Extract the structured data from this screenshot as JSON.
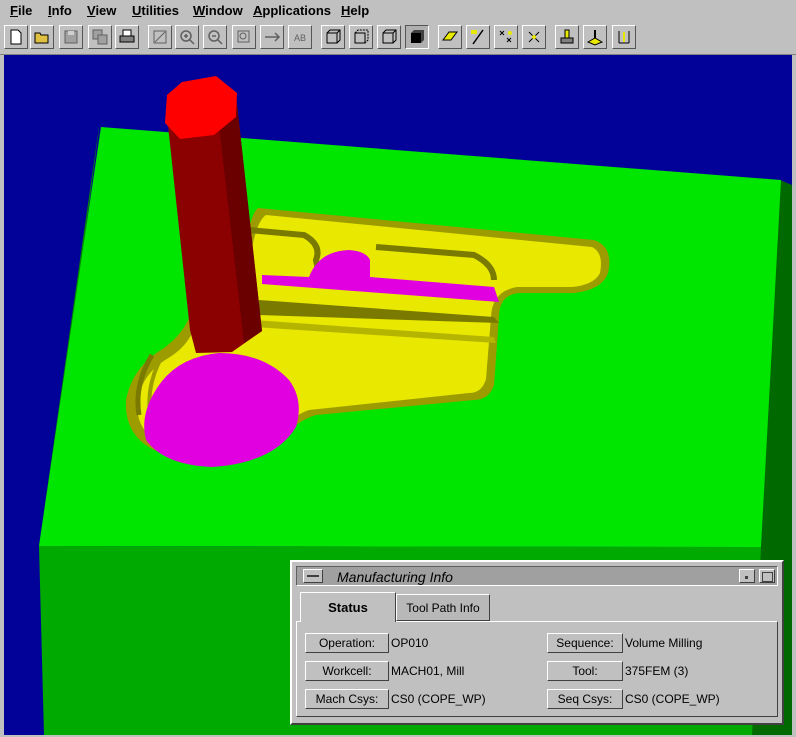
{
  "menu": [
    "File",
    "Info",
    "View",
    "Utilities",
    "Window",
    "Applications",
    "Help"
  ],
  "toolbar": {
    "buttons": [
      "new-file-icon",
      "open-folder-icon",
      "save-icon",
      "save-copy-icon",
      "print-icon",
      "refit-icon",
      "zoom-in-icon",
      "zoom-out-icon",
      "zoom-window-icon",
      "pan-icon",
      "label-icon",
      "wireframe-icon",
      "hidden-line-icon",
      "no-hidden-icon",
      "shading-icon",
      "datum-plane-icon",
      "datum-axis-icon",
      "datum-point-icon",
      "coord-sys-icon",
      "mfg-setup-icon",
      "nc-sequence-icon",
      "tool-path-icon"
    ]
  },
  "model_colors": {
    "background": "#020299",
    "stock_top": "#00e600",
    "stock_side": "#008800",
    "pocket_floor": "#e8e800",
    "pocket_wall": "#9c9c00",
    "hole_floor": "#e000e0",
    "tool_body": "#8b0000",
    "tool_tip": "#ff0000"
  },
  "dialog": {
    "title": "Manufacturing Info",
    "tabs": [
      "Status",
      "Tool Path Info"
    ],
    "active_tab": "Status",
    "fields": [
      {
        "label": "Operation:",
        "value": "OP010"
      },
      {
        "label": "Sequence:",
        "value": "Volume Milling"
      },
      {
        "label": "Workcell:",
        "value": "MACH01, Mill"
      },
      {
        "label": "Tool:",
        "value": "375FEM (3)"
      },
      {
        "label": "Mach Csys:",
        "value": "CS0 (COPE_WP)"
      },
      {
        "label": "Seq Csys:",
        "value": "CS0 (COPE_WP)"
      }
    ]
  }
}
